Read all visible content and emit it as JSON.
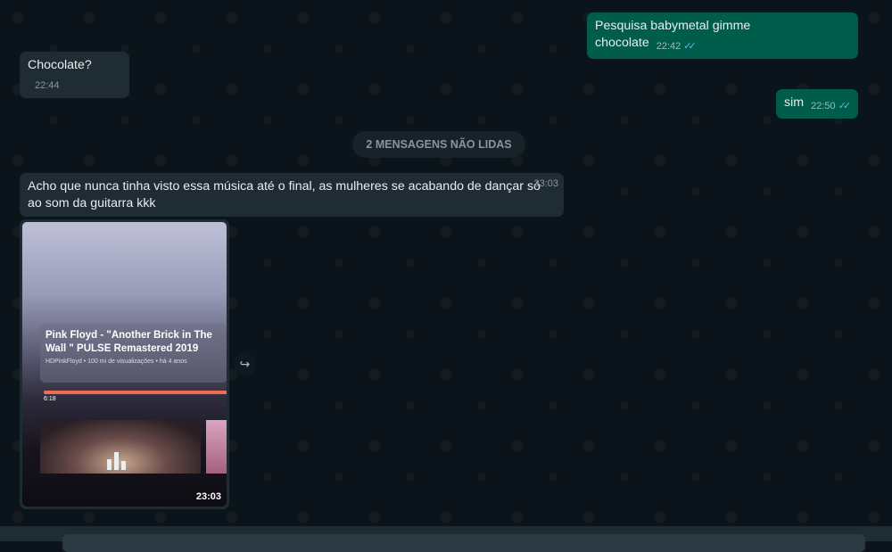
{
  "messages": [
    {
      "dir": "out",
      "text": "Pesquisa babymetal gimme chocolate",
      "time": "22:42",
      "status": "read"
    },
    {
      "dir": "in",
      "text": "Chocolate?",
      "time": "22:44"
    },
    {
      "dir": "out",
      "text": "sim",
      "time": "22:50",
      "status": "read"
    }
  ],
  "unread_label": "2 MENSAGENS NÃO LIDAS",
  "long_message": {
    "text": "Acho que nunca tinha visto essa música até o final, as mulheres se acabando de dançar só ao som da guitarra kkk",
    "time": "23:03"
  },
  "video": {
    "title": "Pink Floyd - \"Another Brick in The Wall \" PULSE Remastered 2019",
    "meta": "HDPinkFloyd • 100 mi de visualizações • há 4 anos",
    "duration": "6:18",
    "time": "23:03",
    "progress_percent": 100
  },
  "ticks_glyph": "✓✓",
  "forward_icon": "↪",
  "colors": {
    "background": "#0b141a",
    "incoming": "#202c33",
    "outgoing": "#005c4b",
    "read_ticks": "#53bdeb"
  }
}
